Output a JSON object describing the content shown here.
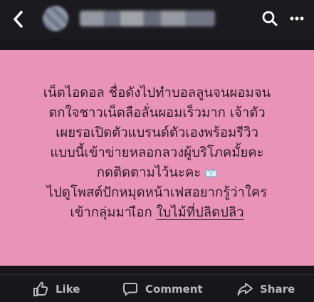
{
  "header": {
    "back_icon": "chevron-left-icon",
    "search_icon": "search-icon",
    "more_icon": "more-dots-icon",
    "avatar": "blurred-avatar",
    "blurred_text": "blurred-account-name"
  },
  "post": {
    "background_color": "#e993b7",
    "text_color": "#2a1b24",
    "lines": {
      "line_1": "เน็ตไอดอล ชื่อดังไปทำบอลลูนจนผอมจน",
      "line_2": "ตกใจชาวเน็ตลือลั่นผอมเร็วมาก เจ้าตัว",
      "line_3": "เผยรอเปิดตัวแบรนด์ตัวเองพร้อมรีวิว",
      "line_4": "แบบนี้เข้าข่ายหลอกลวงผู้บริโภคมั้ยคะ",
      "line_5": "กดติดตามไว้นะคะ",
      "line_6": "ไปดูโพสต์ปักหมุดหน้าเฟสอยากรู้ว่าใคร",
      "line_7_prefix": "เข้ากลุ่มมาเ",
      "line_7_link": "ใบไม้ที่ปลิดปลิว",
      "emoji": "package-emoji"
    }
  },
  "actions": {
    "like": "Like",
    "comment": "Comment",
    "share": "Share",
    "like_icon": "thumb-up-icon",
    "comment_icon": "comment-icon",
    "share_icon": "share-icon"
  }
}
